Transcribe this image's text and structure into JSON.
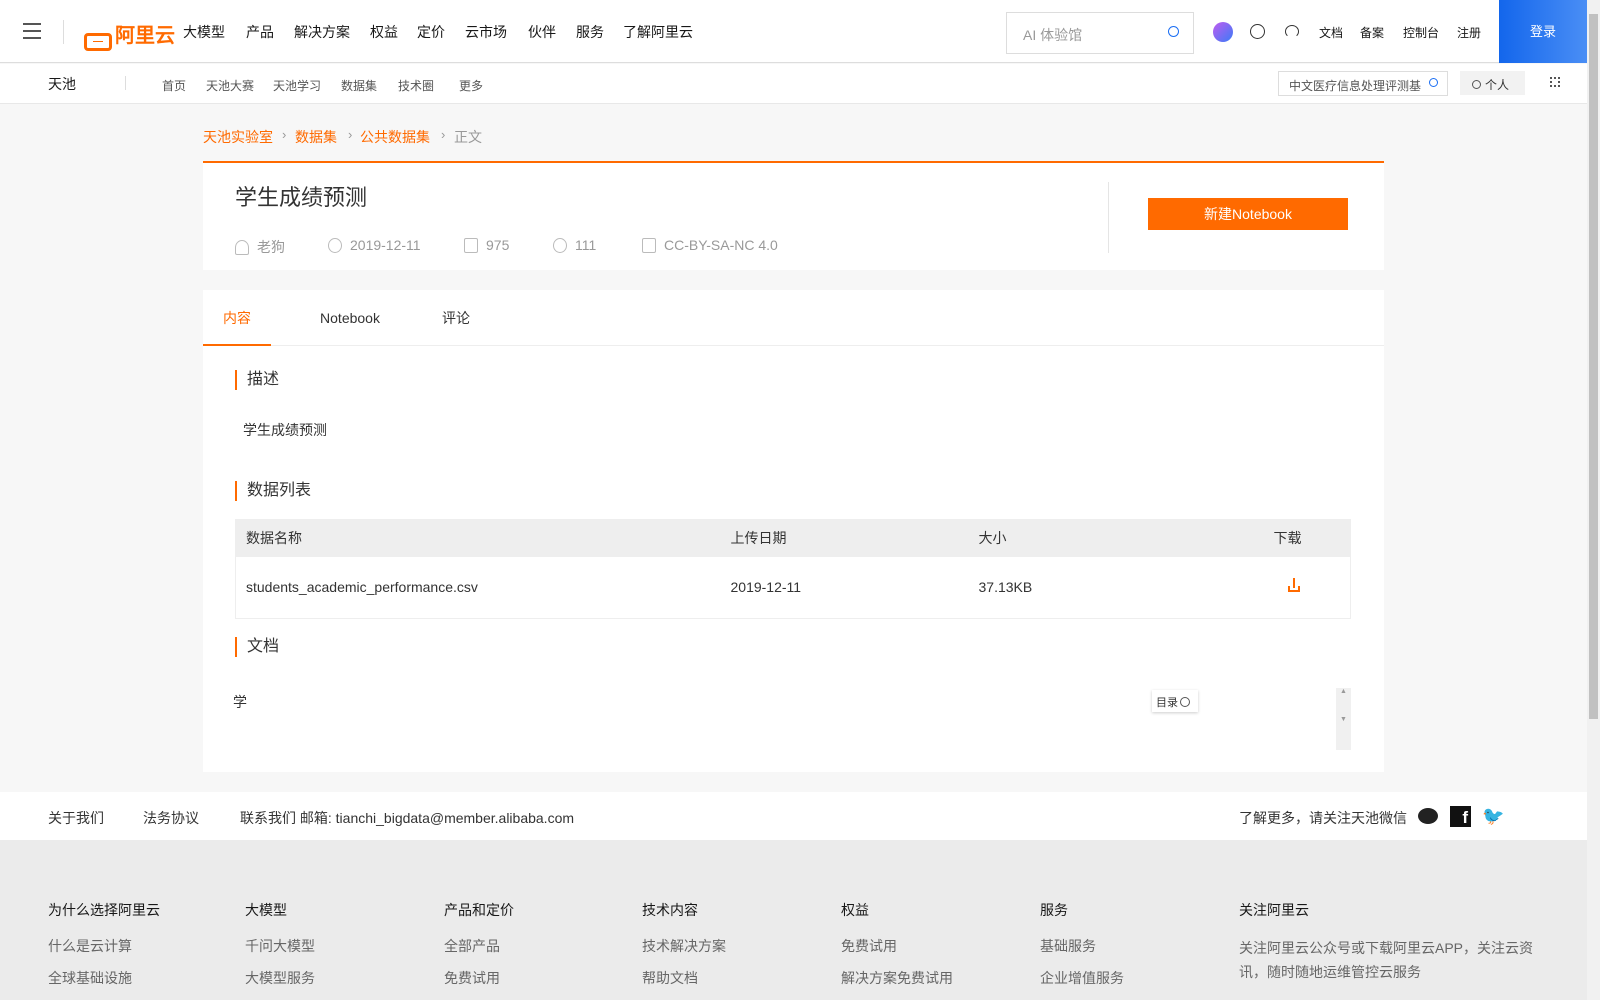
{
  "topnav": {
    "logo": "阿里云",
    "items": [
      "大模型",
      "产品",
      "解决方案",
      "权益",
      "定价",
      "云市场",
      "伙伴",
      "服务",
      "了解阿里云"
    ],
    "search_placeholder": "AI 体验馆",
    "right_links": [
      "文档",
      "备案",
      "控制台",
      "注册"
    ],
    "login": "登录"
  },
  "subnav": {
    "brand": "天池",
    "items": [
      "首页",
      "天池大赛",
      "天池学习",
      "数据集",
      "技术圈",
      "更多"
    ],
    "search_value": "中文医疗信息处理评测基",
    "personal": "个人"
  },
  "breadcrumb": [
    "天池实验室",
    "数据集",
    "公共数据集",
    "正文"
  ],
  "dataset": {
    "title": "学生成绩预测",
    "author": "老狗",
    "date": "2019-12-11",
    "downloads": "975",
    "shares": "111",
    "license": "CC-BY-SA-NC 4.0",
    "new_notebook": "新建Notebook"
  },
  "tabs": [
    "内容",
    "Notebook",
    "评论"
  ],
  "content": {
    "desc_title": "描述",
    "desc": "学生成绩预测",
    "list_title": "数据列表",
    "columns": [
      "数据名称",
      "上传日期",
      "大小",
      "下载"
    ],
    "rows": [
      {
        "name": "students_academic_performance.csv",
        "date": "2019-12-11",
        "size": "37.13KB"
      }
    ],
    "doc_title": "文档",
    "doc_text": "学",
    "toc": "目录"
  },
  "footer": {
    "links": [
      "关于我们",
      "法务协议"
    ],
    "contact": "联系我们 邮箱: tianchi_bigdata@member.alibaba.com",
    "follow": "了解更多，请关注天池微信",
    "columns": [
      {
        "title": "为什么选择阿里云",
        "items": [
          "什么是云计算",
          "全球基础设施"
        ]
      },
      {
        "title": "大模型",
        "items": [
          "千问大模型",
          "大模型服务"
        ]
      },
      {
        "title": "产品和定价",
        "items": [
          "全部产品",
          "免费试用"
        ]
      },
      {
        "title": "技术内容",
        "items": [
          "技术解决方案",
          "帮助文档"
        ]
      },
      {
        "title": "权益",
        "items": [
          "免费试用",
          "解决方案免费试用"
        ]
      },
      {
        "title": "服务",
        "items": [
          "基础服务",
          "企业增值服务"
        ]
      },
      {
        "title": "关注阿里云",
        "items": [
          "关注阿里云公众号或下载阿里云APP，关注云资讯，随时随地运维管控云服务"
        ]
      }
    ]
  },
  "colors": {
    "accent": "#ff6a00",
    "login": "#1b6ef3"
  }
}
